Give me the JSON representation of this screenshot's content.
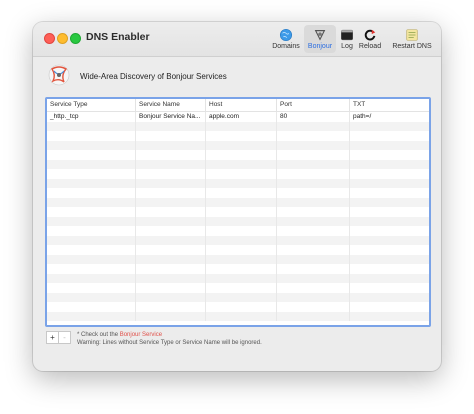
{
  "app": {
    "title": "DNS Enabler"
  },
  "toolbar": {
    "items": [
      {
        "label": "Domains",
        "icon": "globe-icon"
      },
      {
        "label": "Bonjour",
        "icon": "bonjour-icon",
        "selected": true
      },
      {
        "label": "Log",
        "icon": "terminal-icon"
      },
      {
        "label": "Reload",
        "icon": "reload-icon"
      },
      {
        "label": "Restart DNS",
        "icon": "notepad-icon"
      }
    ]
  },
  "main": {
    "heading": "Wide-Area Discovery of Bonjour Services",
    "table": {
      "columns": [
        "Service Type",
        "Service Name",
        "Host",
        "Port",
        "TXT"
      ],
      "rows": [
        [
          "_http._tcp",
          "Bonjour Service Na...",
          "apple.com",
          "80",
          "path=/"
        ]
      ]
    }
  },
  "footer": {
    "add_label": "+",
    "remove_label": "-",
    "note_prefix": "* Check out the ",
    "note_link": "Bonjour Service",
    "note_warning": "Warning: Lines without Service Type or Service Name will be ignored."
  },
  "colors": {
    "accent": "#2b6de0",
    "table_border": "#7aa3e8",
    "link": "#e0514a"
  }
}
